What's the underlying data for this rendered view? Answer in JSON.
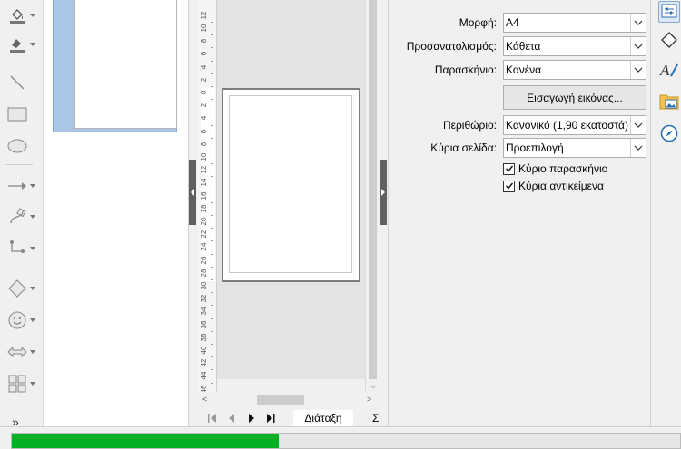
{
  "properties": {
    "format": {
      "label": "Μορφή:",
      "value": "A4"
    },
    "orientation": {
      "label": "Προσανατολισμός:",
      "value": "Κάθετα"
    },
    "background": {
      "label": "Παρασκήνιο:",
      "value": "Κανένα"
    },
    "insert_image_label": "Εισαγωγή εικόνας...",
    "margins": {
      "label": "Περιθώριο:",
      "value": "Κανονικό (1,90 εκατοστά)"
    },
    "master_slide": {
      "label": "Κύρια σελίδα:",
      "value": "Προεπιλογή"
    },
    "master_background": {
      "label": "Κύριο παρασκήνιο",
      "checked": true
    },
    "master_objects": {
      "label": "Κύρια αντικείμενα",
      "checked": true
    }
  },
  "tabs": {
    "active": "Διάταξη",
    "next_partial": "Σ"
  },
  "toolbar": {
    "more_label": "»",
    "items": [
      "fill-color-icon",
      "line-color-icon",
      "line-icon",
      "rectangle-icon",
      "ellipse-icon",
      "arrow-icon",
      "curve-icon",
      "connector-icon",
      "diamond-shape-icon",
      "smiley-icon",
      "double-arrow-icon",
      "layout-grid-icon"
    ]
  },
  "ruler": {
    "labels": [
      "12",
      "10",
      "8",
      "6",
      "4",
      "2",
      "0",
      "2",
      "4",
      "6",
      "8",
      "10",
      "12",
      "14",
      "16",
      "18",
      "20",
      "22",
      "24",
      "26",
      "28",
      "30",
      "32",
      "34",
      "36",
      "38",
      "40",
      "42",
      "44",
      "46"
    ]
  },
  "status": {
    "progress_fraction": 0.4
  },
  "colors": {
    "progress": "#06b025",
    "selection": "#a9c6e6",
    "handle": "#5f5f5f"
  }
}
